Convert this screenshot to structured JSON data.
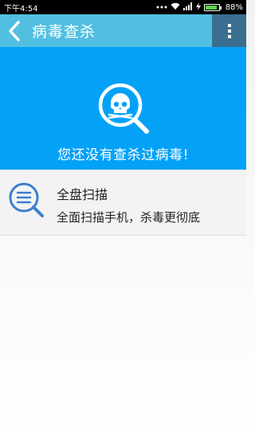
{
  "status_bar": {
    "time": "下午4:54",
    "battery_percent": "88%",
    "battery_level": 0.88,
    "icons": [
      "notification-dots-icon",
      "wifi-icon",
      "signal-icon",
      "charging-icon",
      "battery-icon"
    ]
  },
  "app_bar": {
    "title": "病毒查杀",
    "back_icon": "chevron-left-icon",
    "menu_icon": "more-vertical-icon",
    "background": "#52bfe1",
    "menu_background": "#3a6f8f"
  },
  "hero": {
    "message": "您还没有查杀过病毒!",
    "icon": "skull-search-icon",
    "background": "#03a2f7"
  },
  "scan_option": {
    "title": "全盘扫描",
    "description": "全面扫描手机，杀毒更彻底",
    "icon": "list-search-icon",
    "accent": "#3a7fcf"
  }
}
